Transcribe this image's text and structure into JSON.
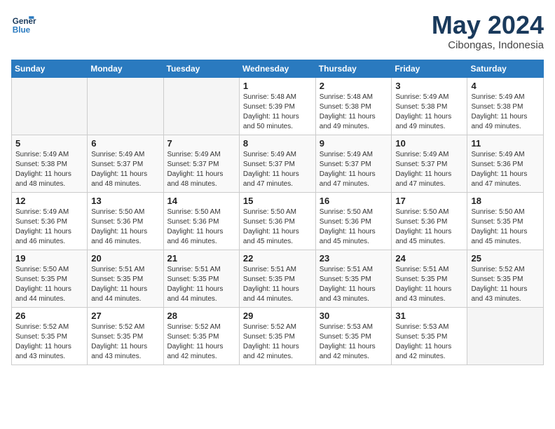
{
  "logo": {
    "line1": "General",
    "line2": "Blue"
  },
  "title": "May 2024",
  "subtitle": "Cibongas, Indonesia",
  "days_header": [
    "Sunday",
    "Monday",
    "Tuesday",
    "Wednesday",
    "Thursday",
    "Friday",
    "Saturday"
  ],
  "weeks": [
    [
      {
        "day": "",
        "info": ""
      },
      {
        "day": "",
        "info": ""
      },
      {
        "day": "",
        "info": ""
      },
      {
        "day": "1",
        "info": "Sunrise: 5:48 AM\nSunset: 5:39 PM\nDaylight: 11 hours\nand 50 minutes."
      },
      {
        "day": "2",
        "info": "Sunrise: 5:48 AM\nSunset: 5:38 PM\nDaylight: 11 hours\nand 49 minutes."
      },
      {
        "day": "3",
        "info": "Sunrise: 5:49 AM\nSunset: 5:38 PM\nDaylight: 11 hours\nand 49 minutes."
      },
      {
        "day": "4",
        "info": "Sunrise: 5:49 AM\nSunset: 5:38 PM\nDaylight: 11 hours\nand 49 minutes."
      }
    ],
    [
      {
        "day": "5",
        "info": "Sunrise: 5:49 AM\nSunset: 5:38 PM\nDaylight: 11 hours\nand 48 minutes."
      },
      {
        "day": "6",
        "info": "Sunrise: 5:49 AM\nSunset: 5:37 PM\nDaylight: 11 hours\nand 48 minutes."
      },
      {
        "day": "7",
        "info": "Sunrise: 5:49 AM\nSunset: 5:37 PM\nDaylight: 11 hours\nand 48 minutes."
      },
      {
        "day": "8",
        "info": "Sunrise: 5:49 AM\nSunset: 5:37 PM\nDaylight: 11 hours\nand 47 minutes."
      },
      {
        "day": "9",
        "info": "Sunrise: 5:49 AM\nSunset: 5:37 PM\nDaylight: 11 hours\nand 47 minutes."
      },
      {
        "day": "10",
        "info": "Sunrise: 5:49 AM\nSunset: 5:37 PM\nDaylight: 11 hours\nand 47 minutes."
      },
      {
        "day": "11",
        "info": "Sunrise: 5:49 AM\nSunset: 5:36 PM\nDaylight: 11 hours\nand 47 minutes."
      }
    ],
    [
      {
        "day": "12",
        "info": "Sunrise: 5:49 AM\nSunset: 5:36 PM\nDaylight: 11 hours\nand 46 minutes."
      },
      {
        "day": "13",
        "info": "Sunrise: 5:50 AM\nSunset: 5:36 PM\nDaylight: 11 hours\nand 46 minutes."
      },
      {
        "day": "14",
        "info": "Sunrise: 5:50 AM\nSunset: 5:36 PM\nDaylight: 11 hours\nand 46 minutes."
      },
      {
        "day": "15",
        "info": "Sunrise: 5:50 AM\nSunset: 5:36 PM\nDaylight: 11 hours\nand 45 minutes."
      },
      {
        "day": "16",
        "info": "Sunrise: 5:50 AM\nSunset: 5:36 PM\nDaylight: 11 hours\nand 45 minutes."
      },
      {
        "day": "17",
        "info": "Sunrise: 5:50 AM\nSunset: 5:36 PM\nDaylight: 11 hours\nand 45 minutes."
      },
      {
        "day": "18",
        "info": "Sunrise: 5:50 AM\nSunset: 5:35 PM\nDaylight: 11 hours\nand 45 minutes."
      }
    ],
    [
      {
        "day": "19",
        "info": "Sunrise: 5:50 AM\nSunset: 5:35 PM\nDaylight: 11 hours\nand 44 minutes."
      },
      {
        "day": "20",
        "info": "Sunrise: 5:51 AM\nSunset: 5:35 PM\nDaylight: 11 hours\nand 44 minutes."
      },
      {
        "day": "21",
        "info": "Sunrise: 5:51 AM\nSunset: 5:35 PM\nDaylight: 11 hours\nand 44 minutes."
      },
      {
        "day": "22",
        "info": "Sunrise: 5:51 AM\nSunset: 5:35 PM\nDaylight: 11 hours\nand 44 minutes."
      },
      {
        "day": "23",
        "info": "Sunrise: 5:51 AM\nSunset: 5:35 PM\nDaylight: 11 hours\nand 43 minutes."
      },
      {
        "day": "24",
        "info": "Sunrise: 5:51 AM\nSunset: 5:35 PM\nDaylight: 11 hours\nand 43 minutes."
      },
      {
        "day": "25",
        "info": "Sunrise: 5:52 AM\nSunset: 5:35 PM\nDaylight: 11 hours\nand 43 minutes."
      }
    ],
    [
      {
        "day": "26",
        "info": "Sunrise: 5:52 AM\nSunset: 5:35 PM\nDaylight: 11 hours\nand 43 minutes."
      },
      {
        "day": "27",
        "info": "Sunrise: 5:52 AM\nSunset: 5:35 PM\nDaylight: 11 hours\nand 43 minutes."
      },
      {
        "day": "28",
        "info": "Sunrise: 5:52 AM\nSunset: 5:35 PM\nDaylight: 11 hours\nand 42 minutes."
      },
      {
        "day": "29",
        "info": "Sunrise: 5:52 AM\nSunset: 5:35 PM\nDaylight: 11 hours\nand 42 minutes."
      },
      {
        "day": "30",
        "info": "Sunrise: 5:53 AM\nSunset: 5:35 PM\nDaylight: 11 hours\nand 42 minutes."
      },
      {
        "day": "31",
        "info": "Sunrise: 5:53 AM\nSunset: 5:35 PM\nDaylight: 11 hours\nand 42 minutes."
      },
      {
        "day": "",
        "info": ""
      }
    ]
  ]
}
